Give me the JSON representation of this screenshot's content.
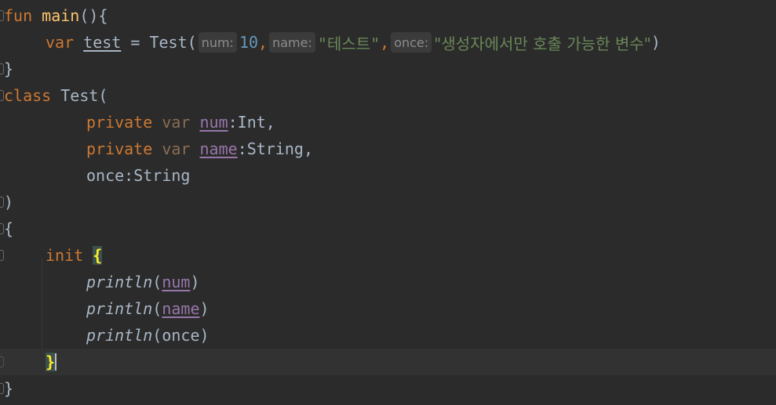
{
  "editor": {
    "lines": {
      "l1": {
        "fun": "fun",
        "name": "main",
        "rest": "(){"
      },
      "l2": {
        "var": "var",
        "varName": "test",
        "eq": " = ",
        "ctor": "Test(",
        "hintNum": "num:",
        "numVal": "10",
        "comma1": ",",
        "hintName": "name:",
        "strName": "\"테스트\"",
        "comma2": ",",
        "hintOnce": "once:",
        "strOnce": "\"생성자에서만 호출 가능한 변수\"",
        "close": ")"
      },
      "l3": {
        "text": "}"
      },
      "l4": {
        "kw": "class",
        "rest": " Test("
      },
      "l5": {
        "priv": "private",
        "var": "var",
        "prop": "num",
        "rest": ":Int,"
      },
      "l6": {
        "priv": "private",
        "var": "var",
        "prop": "name",
        "rest": ":String,"
      },
      "l7": {
        "text": "once:String"
      },
      "l8": {
        "text": ")"
      },
      "l9": {
        "text": "{"
      },
      "l10": {
        "kw": "init",
        "brace": "{"
      },
      "l11": {
        "fn": "println",
        "open": "(",
        "prop": "num",
        "close": ")"
      },
      "l12": {
        "fn": "println",
        "open": "(",
        "prop": "name",
        "close": ")"
      },
      "l13": {
        "fn": "println",
        "rest": "(once)"
      },
      "l14": {
        "brace": "}"
      },
      "l15": {
        "text": "}"
      }
    }
  }
}
